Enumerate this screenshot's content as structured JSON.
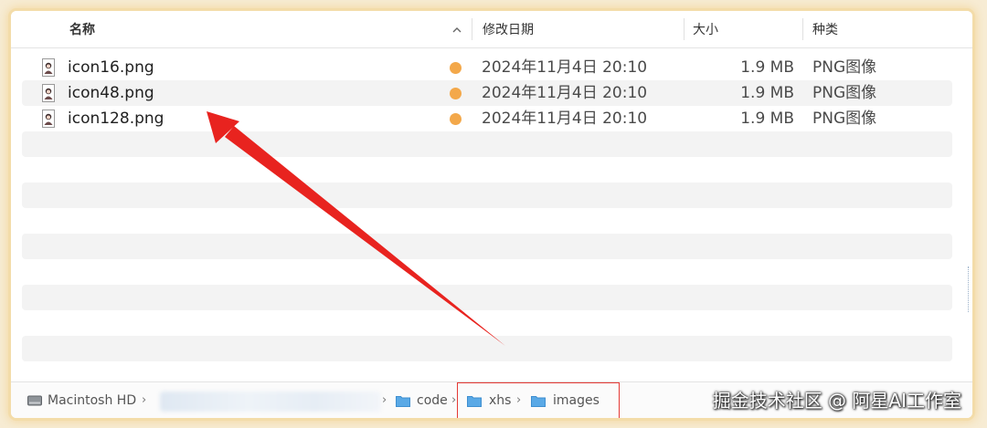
{
  "header": {
    "name_label": "名称",
    "date_label": "修改日期",
    "size_label": "大小",
    "kind_label": "种类"
  },
  "files": [
    {
      "name": "icon16.png",
      "date": "2024年11月4日 20:10",
      "size": "1.9 MB",
      "kind": "PNG图像"
    },
    {
      "name": "icon48.png",
      "date": "2024年11月4日 20:10",
      "size": "1.9 MB",
      "kind": "PNG图像"
    },
    {
      "name": "icon128.png",
      "date": "2024年11月4日 20:10",
      "size": "1.9 MB",
      "kind": "PNG图像"
    }
  ],
  "tag_color": "#f3a84a",
  "pathbar": {
    "disk": "Macintosh HD",
    "folders": [
      "code",
      "xhs",
      "images"
    ]
  },
  "watermark": "掘金技术社区 @ 阿星AI工作室",
  "annotation": {
    "arrow_color": "#e8231f",
    "highlight_color": "#e53935"
  }
}
